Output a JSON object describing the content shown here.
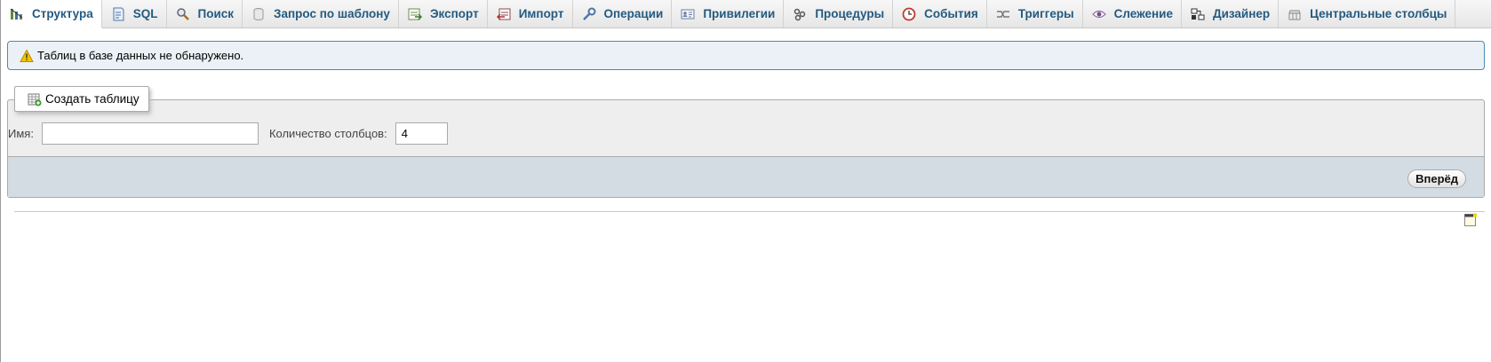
{
  "tabs": [
    {
      "label": "Структура",
      "icon": "structure-icon",
      "active": true
    },
    {
      "label": "SQL",
      "icon": "sql-icon",
      "active": false
    },
    {
      "label": "Поиск",
      "icon": "search-icon",
      "active": false
    },
    {
      "label": "Запрос по шаблону",
      "icon": "query-icon",
      "active": false
    },
    {
      "label": "Экспорт",
      "icon": "export-icon",
      "active": false
    },
    {
      "label": "Импорт",
      "icon": "import-icon",
      "active": false
    },
    {
      "label": "Операции",
      "icon": "wrench-icon",
      "active": false
    },
    {
      "label": "Привилегии",
      "icon": "privileges-icon",
      "active": false
    },
    {
      "label": "Процедуры",
      "icon": "routines-icon",
      "active": false
    },
    {
      "label": "События",
      "icon": "events-icon",
      "active": false
    },
    {
      "label": "Триггеры",
      "icon": "triggers-icon",
      "active": false
    },
    {
      "label": "Слежение",
      "icon": "eye-icon",
      "active": false
    },
    {
      "label": "Дизайнер",
      "icon": "designer-icon",
      "active": false
    },
    {
      "label": "Центральные столбцы",
      "icon": "central-columns-icon",
      "active": false
    }
  ],
  "notice": {
    "icon": "warning-icon",
    "text": "Таблиц в базе данных не обнаружено."
  },
  "create_table": {
    "legend": "Создать таблицу",
    "legend_icon": "new-table-icon",
    "name_label": "Имя:",
    "name_value": "",
    "columns_label": "Количество столбцов:",
    "columns_value": "4",
    "go_label": "Вперёд"
  },
  "colors": {
    "tab_text": "#235a81",
    "notice_border": "#4a8bb2",
    "notice_bg": "#ebf1f6",
    "footer_bg": "#d3dce3"
  }
}
